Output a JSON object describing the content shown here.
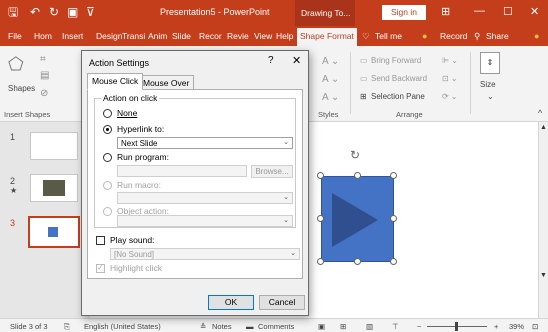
{
  "titlebar": {
    "title": "Presentation5 - PowerPoint",
    "contextual_tab": "Drawing To...",
    "sign_in": "Sign in"
  },
  "tabs": [
    "File",
    "Hom",
    "Insert",
    "Design",
    "Transi",
    "Anim",
    "Slide",
    "Recor",
    "Revie",
    "View",
    "Help",
    "Shape Format"
  ],
  "tell_me": "Tell me",
  "record": "Record",
  "share": "Share",
  "ribbon": {
    "insert_shapes_group": "Insert Shapes",
    "shapes": "Shapes",
    "styles_group": "Styles",
    "bring_forward": "Bring Forward",
    "send_backward": "Send Backward",
    "selection_pane": "Selection Pane",
    "arrange_group": "Arrange",
    "size": "Size"
  },
  "slides": [
    {
      "num": "1"
    },
    {
      "num": "2",
      "star": "★"
    },
    {
      "num": "3"
    }
  ],
  "status": {
    "slide": "Slide 3 of 3",
    "language": "English (United States)",
    "notes": "Notes",
    "comments": "Comments",
    "zoom": "39%"
  },
  "dialog": {
    "title": "Action Settings",
    "help": "?",
    "tab_click": "Mouse Click",
    "tab_over": "Mouse Over",
    "group_label": "Action on click",
    "none": "None",
    "hyperlink": "Hyperlink to:",
    "hyperlink_value": "Next Slide",
    "run_program": "Run program:",
    "browse": "Browse...",
    "run_macro": "Run macro:",
    "object_action": "Object action:",
    "play_sound": "Play sound:",
    "sound_value": "[No Sound]",
    "highlight": "Highlight click",
    "ok": "OK",
    "cancel": "Cancel"
  },
  "colors": {
    "accent": "#c43e1c",
    "shape_fill": "#4472c4",
    "shape_arrow": "#2f4f8f"
  }
}
